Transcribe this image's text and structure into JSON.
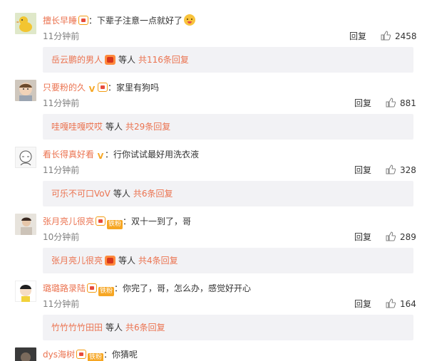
{
  "colors": {
    "username": "#eb7350",
    "text": "#333333",
    "muted": "#808080",
    "reply_bg": "#f2f2f5"
  },
  "labels": {
    "reply": "回复"
  },
  "comments": [
    {
      "username": "擅长早睡",
      "text": "下辈子注意一点就好了",
      "time": "11分钟前",
      "likes": "2458",
      "badges": [
        "crown-badge",
        "smile-emoji"
      ],
      "sub_user": "岳云鹏的男人",
      "sub_deng": "等人",
      "sub_total": "共116条回复"
    },
    {
      "username": "只要粉的久",
      "text": "家里有狗吗",
      "time": "11分钟前",
      "likes": "881",
      "badges": [
        "v-badge",
        "crown-badge"
      ],
      "sub_user": "哇嘎哇嘎哎哎",
      "sub_deng": "等人",
      "sub_total": "共29条回复"
    },
    {
      "username": "看长得真好看",
      "text": "行你试试最好用洗衣液",
      "time": "11分钟前",
      "likes": "328",
      "badges": [
        "v-badge"
      ],
      "sub_user": "可乐不可口VoV",
      "sub_deng": "等人",
      "sub_total": "共6条回复"
    },
    {
      "username": "张月亮儿很亮",
      "text": "双十一到了，哥",
      "time": "10分钟前",
      "likes": "289",
      "badges": [
        "crown-badge",
        "tiefen-badge"
      ],
      "tiefen": "铁粉",
      "sub_user": "张月亮儿很亮",
      "sub_deng": "等人",
      "sub_total": "共4条回复"
    },
    {
      "username": "璐璐路录陆",
      "text": "你完了，哥，怎么办，感觉好开心",
      "time": "11分钟前",
      "likes": "164",
      "badges": [
        "crown-badge",
        "tiefen-badge"
      ],
      "tiefen": "铁粉",
      "sub_user": "竹竹竹竹田田",
      "sub_deng": "等人",
      "sub_total": "共6条回复"
    },
    {
      "username": "dys海树",
      "text": "你猜呢",
      "badges": [
        "crown-badge",
        "tiefen-badge"
      ],
      "tiefen": "铁粉"
    }
  ]
}
